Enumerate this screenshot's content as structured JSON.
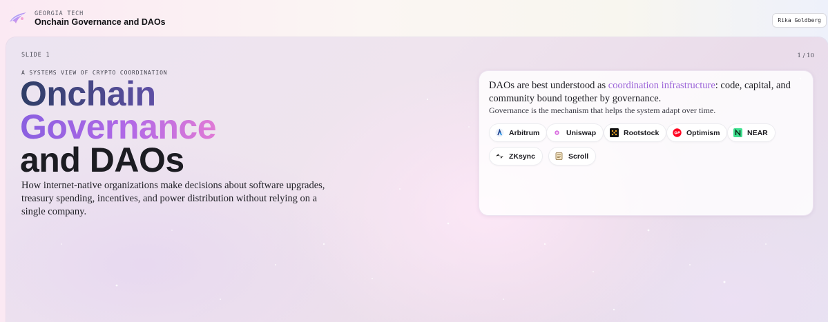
{
  "header": {
    "brand_sub": "GEORGIA TECH",
    "brand_title": "Onchain Governance and DAOs",
    "user_name": "Rika Goldberg"
  },
  "slide": {
    "label": "SLIDE 1",
    "counter": "1 / 10",
    "eyebrow": "A SYSTEMS VIEW OF CRYPTO COORDINATION",
    "headline": [
      "Onchain",
      "Governance",
      "and DAOs"
    ],
    "lede": "How internet-native organizations make decisions about software upgrades, treasury spending, incentives, and power distribution without relying on a single company.",
    "card": {
      "lead_before": "DAOs are best understood as ",
      "lead_highlight": "coordination infrastructure",
      "lead_after": ": code, capital, and community bound together by governance.",
      "sub": "Governance is the mechanism that helps the system adapt over time.",
      "chips": [
        {
          "label": "Arbitrum",
          "icon": "arbitrum-icon"
        },
        {
          "label": "Uniswap",
          "icon": "uniswap-icon"
        },
        {
          "label": "Rootstock",
          "icon": "rootstock-icon"
        },
        {
          "label": "Optimism",
          "icon": "optimism-icon"
        },
        {
          "label": "NEAR",
          "icon": "near-icon"
        },
        {
          "label": "ZKsync",
          "icon": "zksync-icon"
        },
        {
          "label": "Scroll",
          "icon": "scroll-icon"
        }
      ]
    }
  },
  "colors": {
    "accent_purple": "#9b63d8",
    "headline_navy": "#2f3e66",
    "headline_gradient_end": "#e07bd6"
  }
}
